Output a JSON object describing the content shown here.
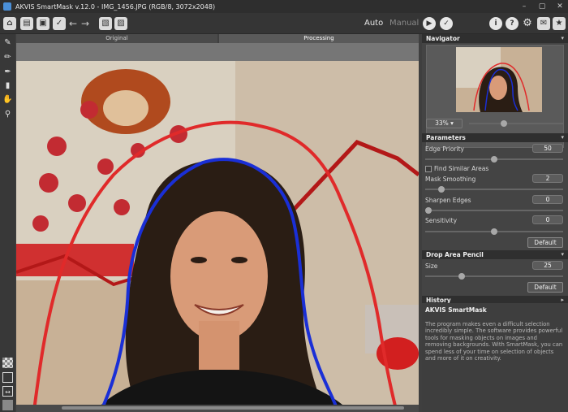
{
  "window": {
    "title": "AKVIS SmartMask v.12.0 - IMG_1456.JPG (RGB/8, 3072x2048)",
    "logo_icon": "akvis-logo-icon",
    "controls": [
      "minimize-icon",
      "maximize-icon",
      "close-icon"
    ]
  },
  "toolbar": {
    "left_buttons": [
      "home-icon",
      "open-icon",
      "save-icon",
      "share-icon",
      "undo-icon",
      "redo-icon",
      "background-icon",
      "image-settings-icon"
    ],
    "mode_auto": "Auto",
    "mode_manual": "Manual",
    "right_buttons": [
      "run-icon",
      "apply-icon",
      "info-icon",
      "help-icon",
      "settings-icon",
      "news-icon",
      "tips-icon"
    ]
  },
  "tools": {
    "top": [
      "keep-pencil-icon",
      "drop-pencil-icon",
      "erase-icon",
      "eraser-icon",
      "hand-icon",
      "zoom-icon"
    ],
    "bottom": [
      "checker-bg-icon",
      "frame-bg-icon",
      "preview-icon",
      "fill-bg-icon"
    ]
  },
  "tabs": {
    "original": "Original",
    "processing": "Processing"
  },
  "navigator": {
    "title": "Navigator",
    "zoom": "33%",
    "zoom_slider_fraction": 0.36
  },
  "parameters": {
    "title": "Parameters",
    "items": [
      {
        "label": "Edge Priority",
        "value": "50",
        "fraction": 0.5
      },
      {
        "label": "Mask Smoothing",
        "value": "2",
        "fraction": 0.1
      },
      {
        "label": "Sharpen Edges",
        "value": "0",
        "fraction": 0.0
      },
      {
        "label": "Sensitivity",
        "value": "0",
        "fraction": 0.5
      }
    ],
    "find_similar_label": "Find Similar Areas",
    "find_similar_checked": false,
    "default_label": "Default"
  },
  "drop_area_pencil": {
    "title": "Drop Area Pencil",
    "size_label": "Size",
    "size_value": "25",
    "size_fraction": 0.25,
    "default_label": "Default"
  },
  "history": {
    "title": "History"
  },
  "about": {
    "title": "AKVIS SmartMask",
    "text": "The program makes even a difficult selection incredibly simple. The software provides powerful tools for masking objects on images and removing backgrounds. With SmartMask, you can spend less of your time on selection of objects and more of it on creativity."
  },
  "colors": {
    "keep_stroke": "#1a2fd6",
    "drop_stroke": "#e02a2a",
    "panel_bg": "#444444",
    "header_bg": "#2f2f2f"
  }
}
